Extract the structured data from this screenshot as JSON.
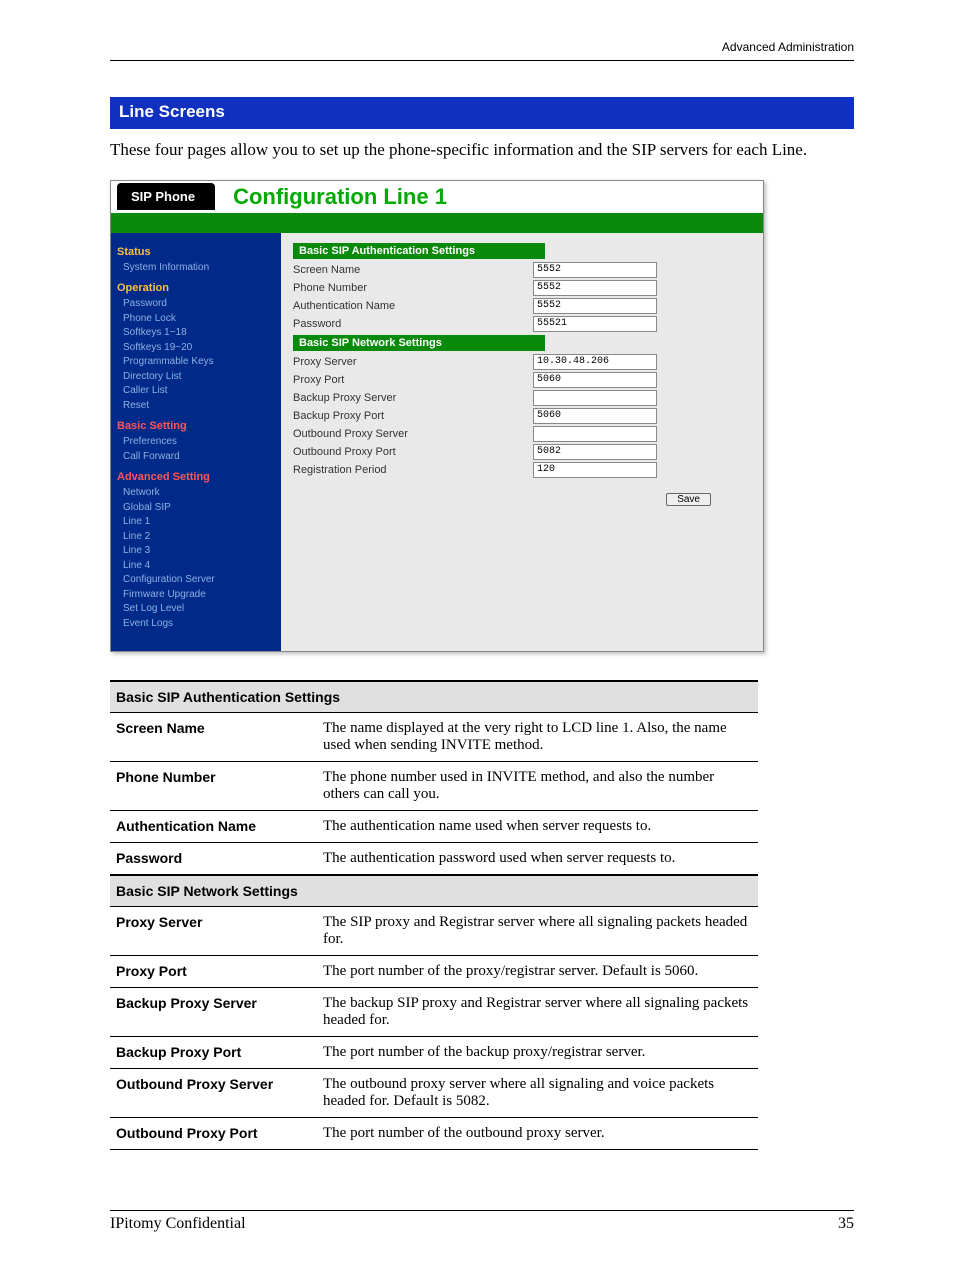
{
  "header_right": "Advanced Administration",
  "section_title": "Line Screens",
  "intro": "These four pages allow you to set up the phone-specific information and the SIP servers for each Line.",
  "screenshot": {
    "tab": "SIP Phone",
    "title": "Configuration Line  1",
    "nav": {
      "status": "Status",
      "status_items": [
        "System Information"
      ],
      "operation": "Operation",
      "operation_items": [
        "Password",
        "Phone Lock",
        "Softkeys 1~18",
        "Softkeys 19~20",
        "Programmable Keys",
        "Directory List",
        "Caller List",
        "Reset"
      ],
      "basic": "Basic Setting",
      "basic_items": [
        "Preferences",
        "Call Forward"
      ],
      "advanced": "Advanced Setting",
      "advanced_items": [
        "Network",
        "Global SIP",
        "Line 1",
        "Line 2",
        "Line 3",
        "Line 4",
        "Configuration Server",
        "Firmware Upgrade",
        "Set Log Level",
        "Event Logs"
      ]
    },
    "group1_head": "Basic SIP Authentication Settings",
    "group1_rows": [
      {
        "label": "Screen Name",
        "value": "5552"
      },
      {
        "label": "Phone Number",
        "value": "5552"
      },
      {
        "label": "Authentication Name",
        "value": "5552"
      },
      {
        "label": "Password",
        "value": "55521"
      }
    ],
    "group2_head": "Basic SIP Network Settings",
    "group2_rows": [
      {
        "label": "Proxy Server",
        "value": "10.30.48.206"
      },
      {
        "label": "Proxy Port",
        "value": "5060"
      },
      {
        "label": "Backup Proxy Server",
        "value": ""
      },
      {
        "label": "Backup Proxy Port",
        "value": "5060"
      },
      {
        "label": "Outbound Proxy Server",
        "value": ""
      },
      {
        "label": "Outbound Proxy Port",
        "value": "5082"
      },
      {
        "label": "Registration Period",
        "value": "120"
      }
    ],
    "save": "Save"
  },
  "desc_table": {
    "sect1": "Basic SIP Authentication Settings",
    "rows1": [
      {
        "name": "Screen Name",
        "desc": "The name displayed at the very right to LCD line 1. Also, the name used when sending INVITE method."
      },
      {
        "name": "Phone Number",
        "desc": "The phone number used in INVITE method, and also the number others can call you."
      },
      {
        "name": "Authentication Name",
        "desc": "The authentication name used when server requests to."
      },
      {
        "name": "Password",
        "desc": "The authentication password used when server requests to."
      }
    ],
    "sect2": "Basic SIP Network Settings",
    "rows2": [
      {
        "name": "Proxy Server",
        "desc": "The SIP proxy and Registrar server where all signaling packets headed for."
      },
      {
        "name": "Proxy Port",
        "desc": "The port number of the proxy/registrar server. Default is 5060."
      },
      {
        "name": "Backup Proxy Server",
        "desc": "The backup SIP proxy and Registrar server where all signaling packets headed for."
      },
      {
        "name": "Backup Proxy Port",
        "desc": "The port number of the backup proxy/registrar server."
      },
      {
        "name": "Outbound Proxy Server",
        "desc": "The outbound proxy server where all signaling and voice packets headed for. Default is 5082."
      },
      {
        "name": "Outbound Proxy Port",
        "desc": "The port number of the outbound proxy server."
      }
    ]
  },
  "footer_left": "IPitomy Confidential",
  "footer_right": "35"
}
